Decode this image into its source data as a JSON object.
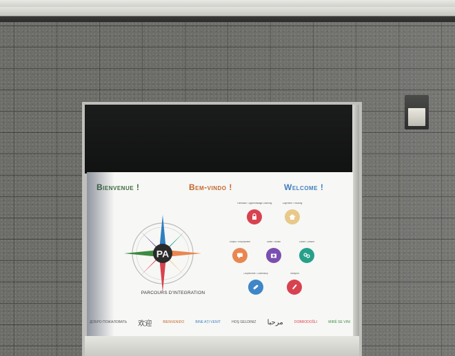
{
  "poster": {
    "greetings": [
      "Bienvenue !",
      "Bem-vindo !",
      "Welcome !"
    ],
    "brand_initials": "PA",
    "brand_name": "PARCOURS D'INTEGRATION",
    "services": [
      {
        "label": "Formation / Apprentissage Learning",
        "icon": "lock-icon",
        "color": "#d8424f"
      },
      {
        "label": "Logement / Housing",
        "icon": "house-icon",
        "color": "#e8c98a"
      },
      {
        "label": "Emploi / Employment",
        "icon": "chat-icon",
        "color": "#e8874f"
      },
      {
        "label": "Santé / Health",
        "icon": "medical-kit-icon",
        "color": "#7a4fb0"
      },
      {
        "label": "Loisirs / Leisure",
        "icon": "people-icon",
        "color": "#27a08a"
      },
      {
        "label": "Citoyenneté / Citizenship",
        "icon": "pill-icon",
        "color": "#3f86c8"
      },
      {
        "label": "Transport",
        "icon": "pen-icon",
        "color": "#d8424f"
      }
    ],
    "languages": [
      "ДОБРО ПОЖАЛОВАТЬ",
      "欢迎",
      "BIENVENIDO",
      "BINE AȚI VENIT",
      "HOŞ GELDINIZ",
      "مرحبا",
      "DOBRODOŠLI",
      "MIRË SE VINI"
    ]
  },
  "colors": {
    "wall": "#6c6d69",
    "poster_bg": "#f7f7f5",
    "greet_fr": "#3b6a3a",
    "greet_pt": "#c1672c",
    "greet_en": "#3f7fbf"
  }
}
